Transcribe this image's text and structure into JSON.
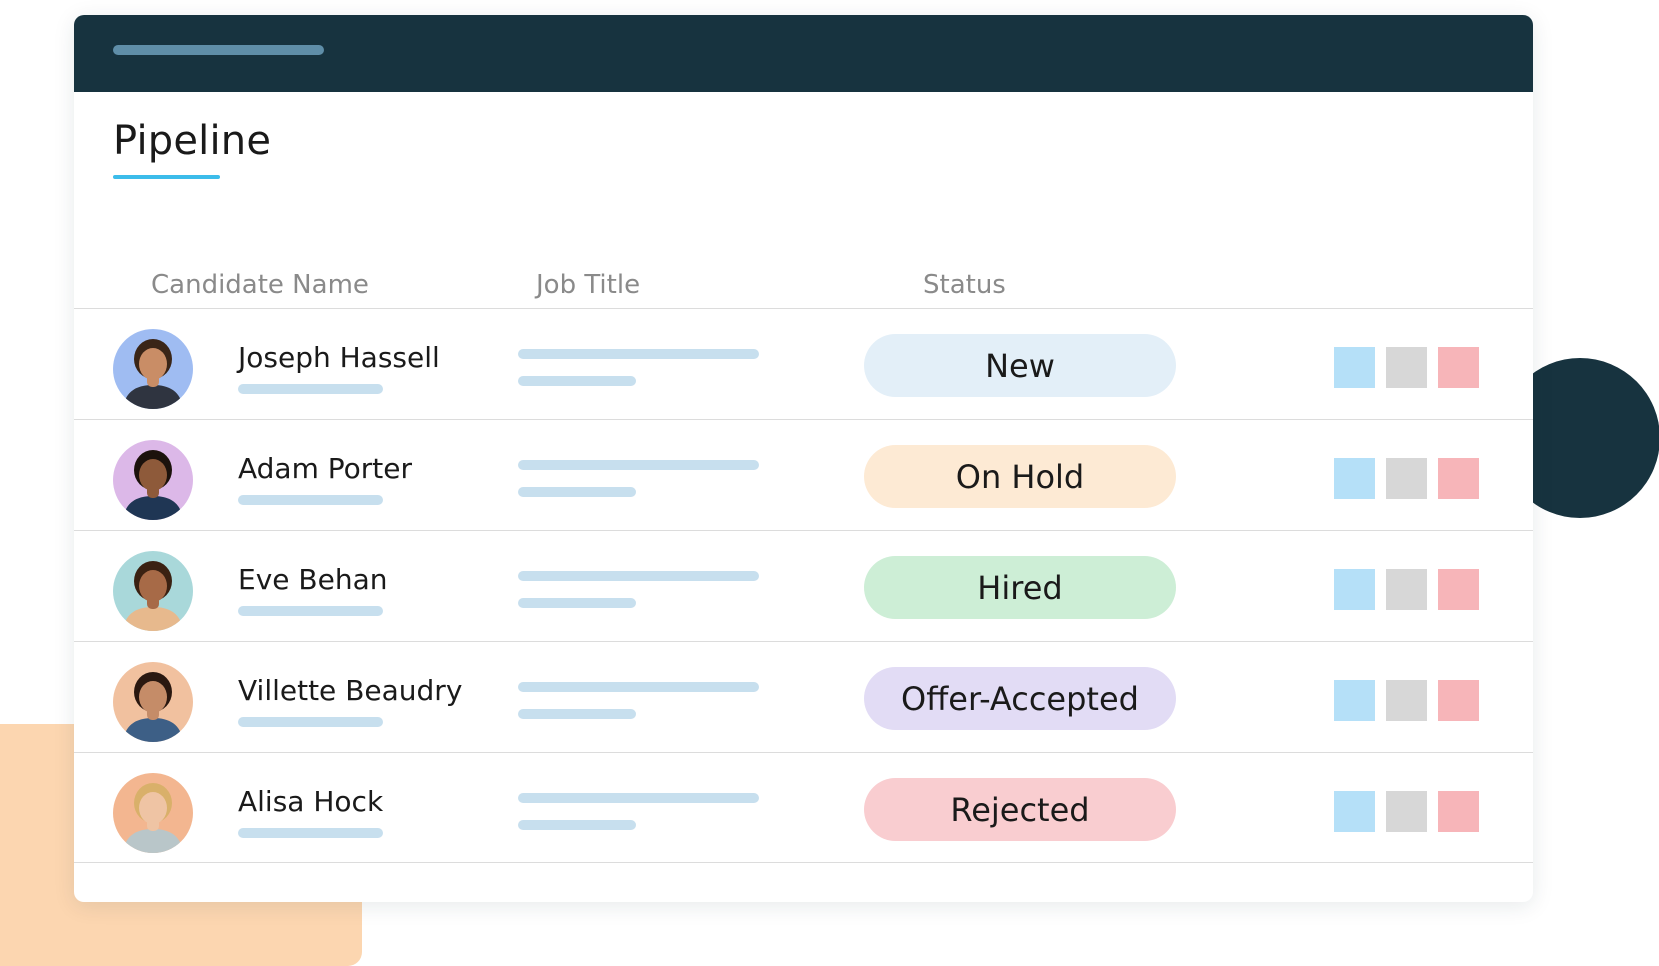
{
  "page_title": "Pipeline",
  "columns": {
    "candidate_name": "Candidate Name",
    "job_title": "Job Title",
    "status": "Status"
  },
  "colors": {
    "header_dark": "#17333f",
    "accent_underline": "#3cbcea",
    "placeholder_bar": "#c7dfee",
    "deco_peach": "#fcd6b0"
  },
  "candidates": [
    {
      "name": "Joseph Hassell",
      "status": "New",
      "status_color": "#e3eff8",
      "avatar_bg": "#9fbcf2",
      "skin": "#c98d66",
      "hair": "#3a2517",
      "shirt": "#2f3440"
    },
    {
      "name": "Adam Porter",
      "status": "On Hold",
      "status_color": "#fdead4",
      "avatar_bg": "#dcb8e8",
      "skin": "#8e5a3a",
      "hair": "#1c120c",
      "shirt": "#1f3654"
    },
    {
      "name": "Eve Behan",
      "status": "Hired",
      "status_color": "#cdeed6",
      "avatar_bg": "#a9d8da",
      "skin": "#a76a47",
      "hair": "#3a2112",
      "shirt": "#e7b98d"
    },
    {
      "name": "Villette Beaudry",
      "status": "Offer-Accepted",
      "status_color": "#e2dcf5",
      "avatar_bg": "#f1c19f",
      "skin": "#c58c68",
      "hair": "#2a1810",
      "shirt": "#3d5f86"
    },
    {
      "name": "Alisa Hock",
      "status": "Rejected",
      "status_color": "#f9cdd0",
      "avatar_bg": "#f3b690",
      "skin": "#efc4a4",
      "hair": "#d9b06a",
      "shirt": "#b9c6c9"
    }
  ],
  "action_icons": [
    "blue-square-icon",
    "grey-square-icon",
    "red-square-icon"
  ]
}
